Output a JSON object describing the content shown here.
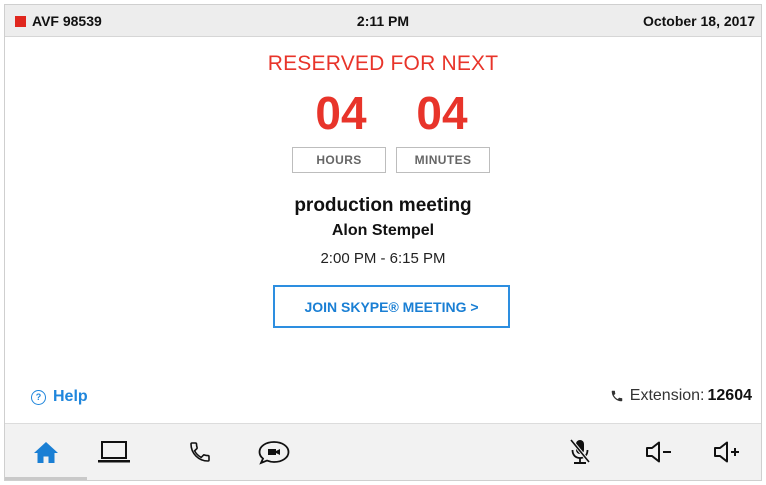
{
  "status": {
    "room_name": "AVF 98539",
    "time": "2:11 PM",
    "date": "October 18, 2017",
    "indicator_color": "#e0271e"
  },
  "reservation": {
    "heading": "RESERVED FOR NEXT",
    "hours_value": "04",
    "minutes_value": "04",
    "hours_label": "HOURS",
    "minutes_label": "MINUTES",
    "accent_color": "#e8342a"
  },
  "meeting": {
    "title": "production meeting",
    "organizer": "Alon Stempel",
    "time_range": "2:00 PM - 6:15 PM"
  },
  "join_button": {
    "label": "JOIN SKYPE® MEETING >"
  },
  "footer": {
    "help_label": "Help",
    "help_icon": "question-icon",
    "extension_label": "Extension:",
    "extension_number": "12604",
    "phone_icon": "phone-icon"
  },
  "nav": {
    "items": [
      {
        "icon": "home-icon",
        "active": true
      },
      {
        "icon": "laptop-icon",
        "active": false
      },
      {
        "icon": "phone-icon",
        "active": false
      },
      {
        "icon": "chat-video-icon",
        "active": false
      },
      {
        "icon": "mic-muted-icon",
        "active": false
      },
      {
        "icon": "volume-down-icon",
        "active": false
      },
      {
        "icon": "volume-up-icon",
        "active": false
      }
    ],
    "active_color": "#1a7fd4"
  }
}
